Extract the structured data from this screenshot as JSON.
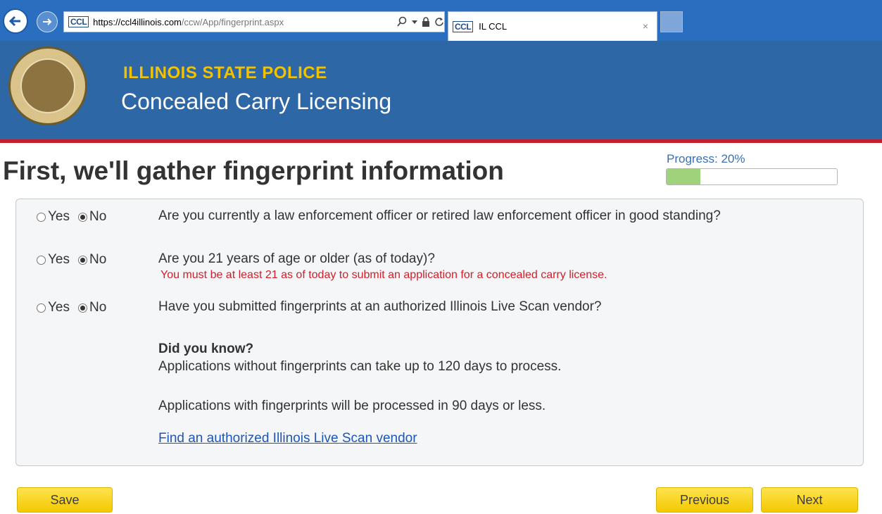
{
  "browser": {
    "address_badge": "CCL",
    "url_main": "https://ccl4illinois.com",
    "url_path": "/ccw/App/fingerprint.aspx",
    "tab_badge": "CCL",
    "tab_title": "IL CCL",
    "tab_close": "×"
  },
  "header": {
    "agency": "ILLINOIS STATE POLICE",
    "program": "Concealed Carry Licensing"
  },
  "page": {
    "title": "First, we'll gather fingerprint information",
    "progress_label": "Progress: 20%",
    "progress_value": 0.2
  },
  "questions": [
    {
      "yes_label": "Yes",
      "no_label": "No",
      "selected": "No",
      "text": "Are you currently a law enforcement officer or retired law enforcement officer in good standing?"
    },
    {
      "yes_label": "Yes",
      "no_label": "No",
      "selected": "No",
      "text": "Are you 21 years of age or older (as of today)?",
      "warning": "You must be at least 21 as of today to submit an application for a concealed carry license."
    },
    {
      "yes_label": "Yes",
      "no_label": "No",
      "selected": "No",
      "text": "Have you submitted fingerprints at an authorized Illinois Live Scan vendor?"
    }
  ],
  "did_you_know": {
    "title": "Did you know?",
    "line1": "Applications without fingerprints can take up to 120 days to process.",
    "line2": "Applications with fingerprints will be processed in 90 days or less.",
    "link": "Find an authorized Illinois Live Scan vendor"
  },
  "buttons": {
    "save": "Save",
    "previous": "Previous",
    "next": "Next"
  },
  "colors": {
    "banner": "#2e67a6",
    "stripe": "#c21f2a",
    "agency_text": "#f2c200",
    "warning_text": "#d0202b",
    "link": "#1e56b8",
    "button": "#f3c900",
    "progress_fill": "#9fd27b"
  }
}
